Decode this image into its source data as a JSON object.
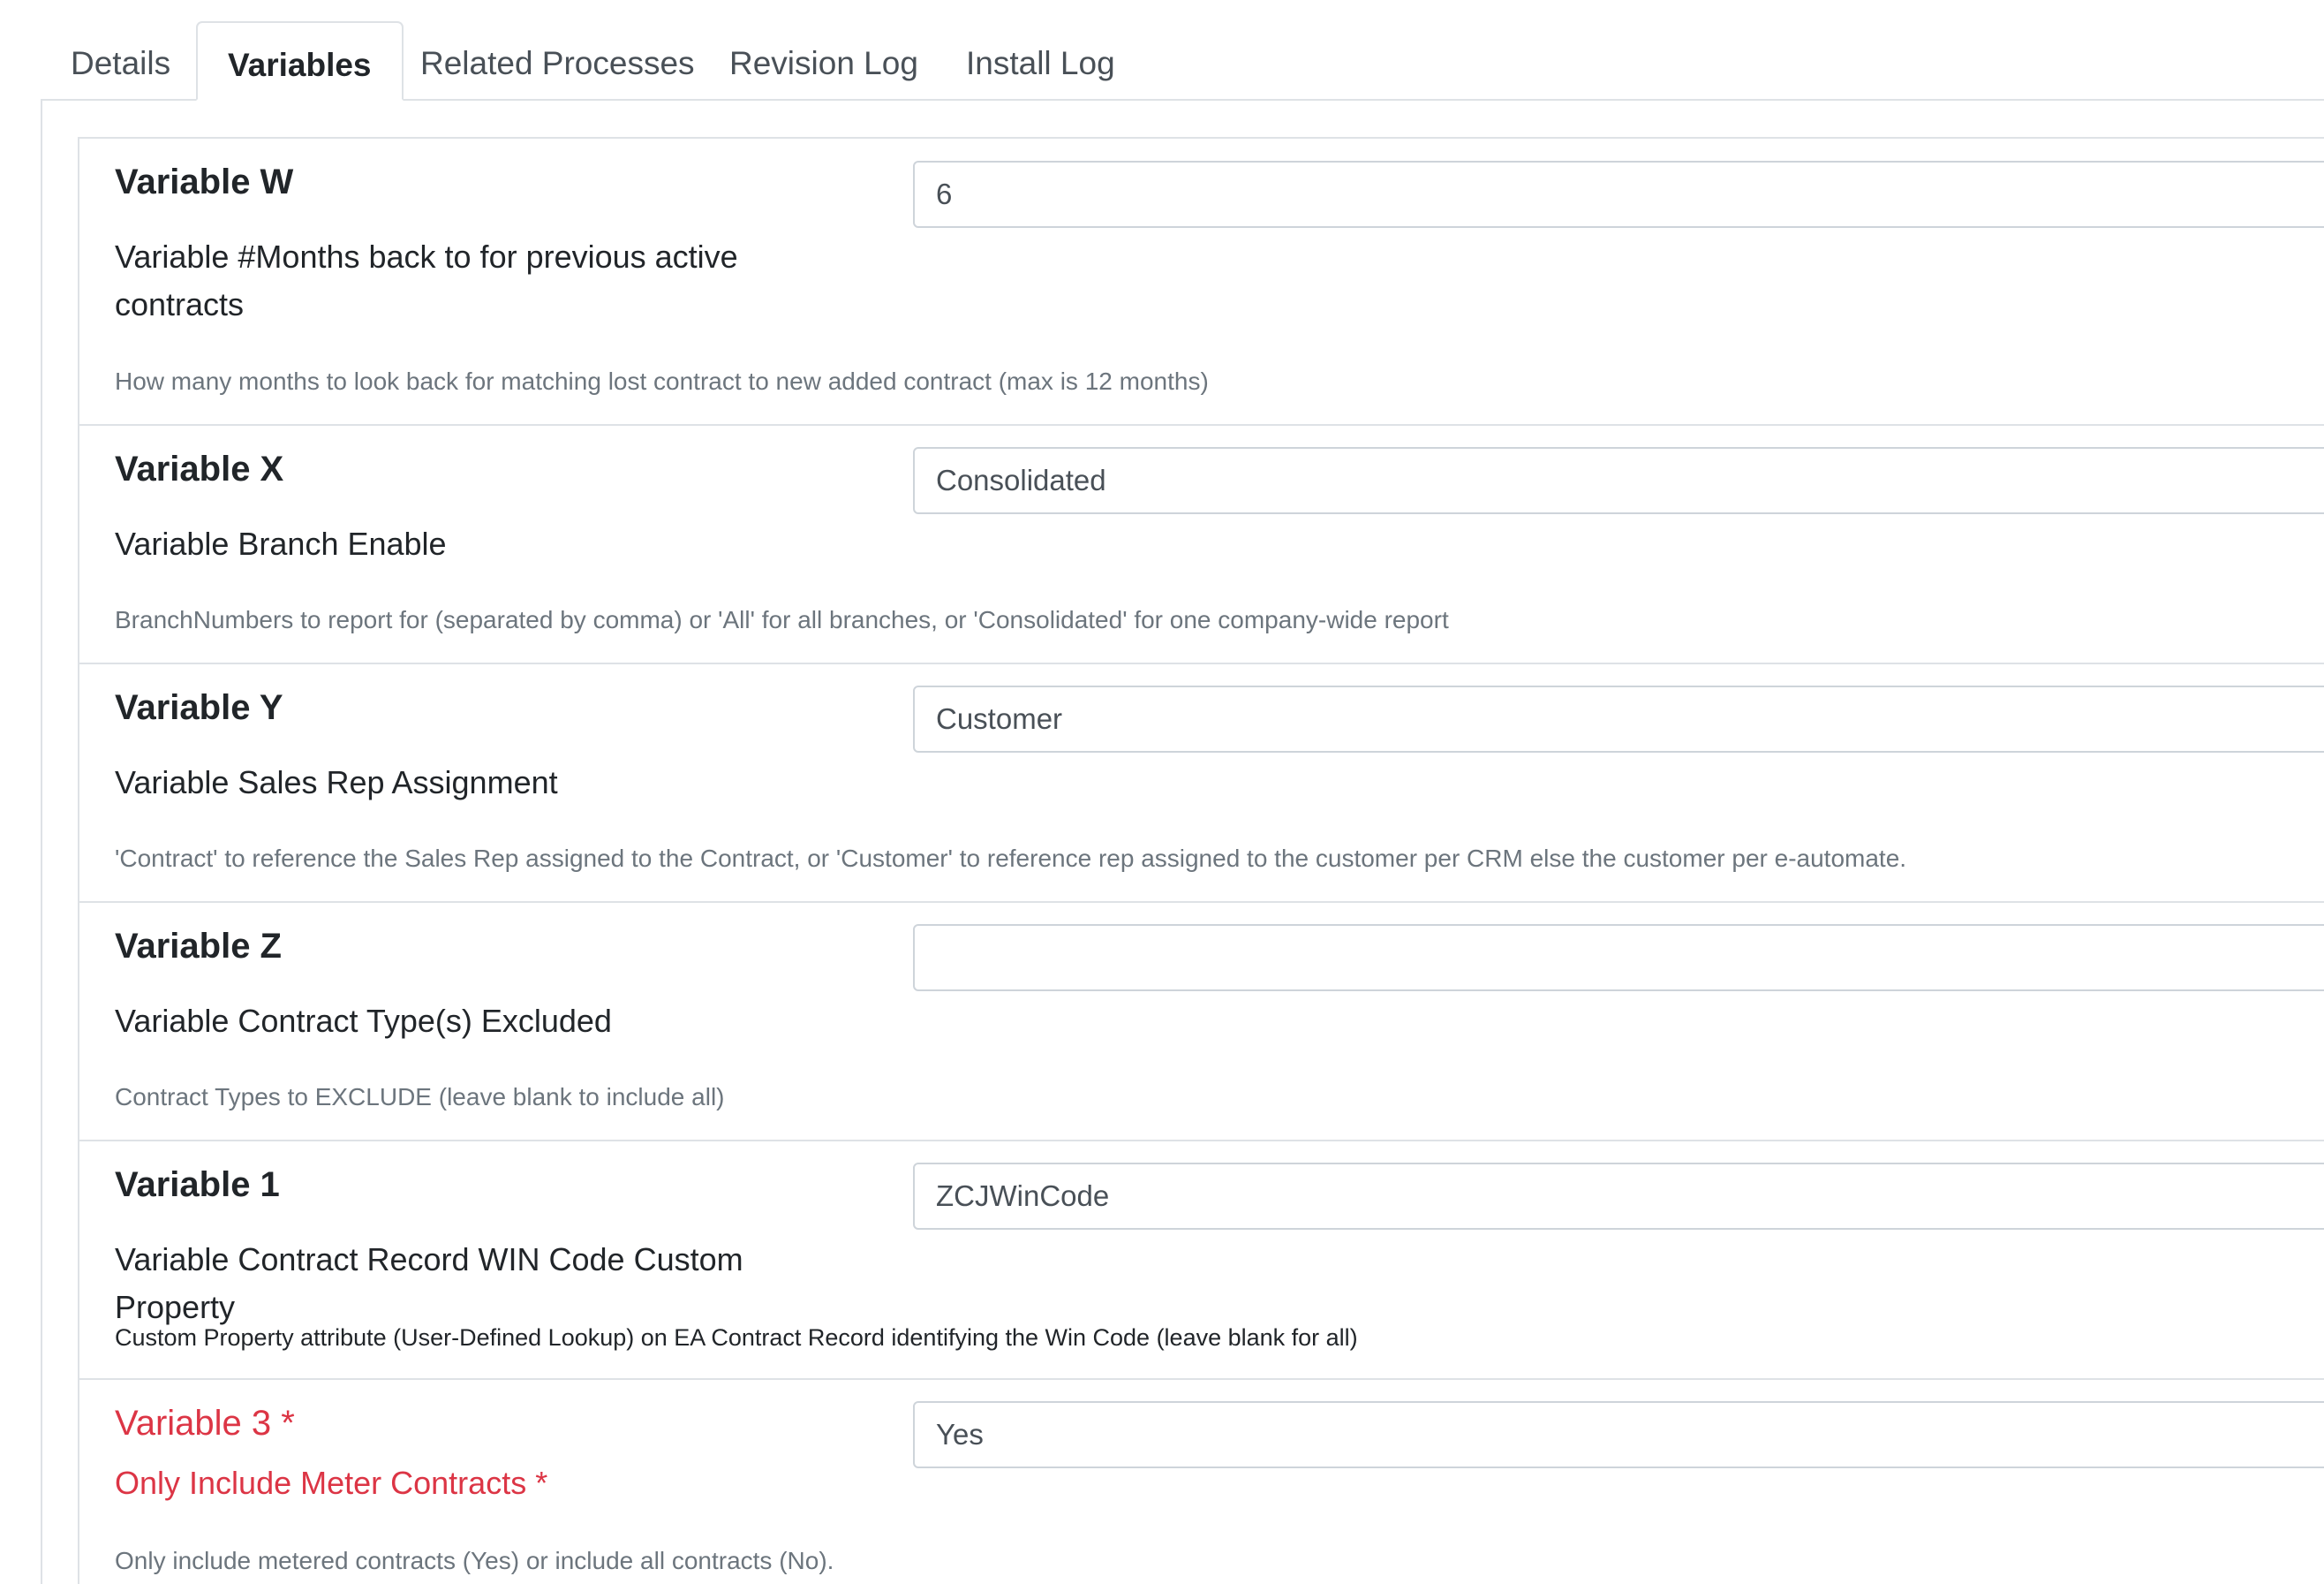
{
  "tabs": [
    {
      "label": "Details",
      "active": false
    },
    {
      "label": "Variables",
      "active": true
    },
    {
      "label": "Related Processes",
      "active": false
    },
    {
      "label": "Revision Log",
      "active": false
    },
    {
      "label": "Install Log",
      "active": false
    }
  ],
  "variables": [
    {
      "title": "Variable W",
      "label": "Variable #Months back to for previous active contracts",
      "value": "6",
      "help": "How many months to look back for matching lost contract to new added contract (max is 12 months)"
    },
    {
      "title": "Variable X",
      "label": "Variable Branch Enable",
      "value": "Consolidated",
      "help": "BranchNumbers to report for (separated by comma) or 'All' for all branches, or 'Consolidated' for one company-wide report"
    },
    {
      "title": "Variable Y",
      "label": "Variable Sales Rep Assignment",
      "value": "Customer",
      "help": "'Contract' to reference the Sales Rep assigned to the Contract, or 'Customer' to reference rep assigned to the customer per CRM else the customer per e-automate."
    },
    {
      "title": "Variable Z",
      "label": "Variable Contract Type(s) Excluded",
      "value": "",
      "help": "Contract Types to EXCLUDE (leave blank to include all)"
    },
    {
      "title": "Variable 1",
      "label": "Variable Contract Record WIN Code Custom Property",
      "value": "ZCJWinCode",
      "help": "Custom Property attribute (User-Defined Lookup) on EA Contract Record identifying the Win Code (leave blank for all)"
    },
    {
      "title": "Variable 3 *",
      "label": "Only Include Meter Contracts *",
      "value": "Yes",
      "help": "Only include metered contracts (Yes) or include all contracts (No)."
    }
  ],
  "colors": {
    "required": "#dc3545",
    "help_text": "#6c757d",
    "border": "#dee2e6",
    "input_border": "#ced4da"
  }
}
